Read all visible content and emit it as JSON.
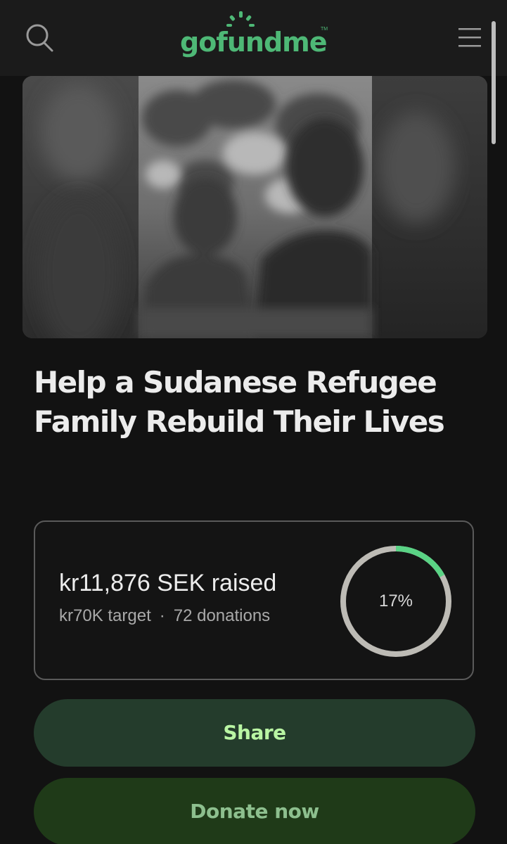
{
  "header": {
    "logo_text": "gofundme",
    "logo_tm": "TM",
    "search_icon": "search-icon",
    "menu_icon": "hamburger-menu-icon"
  },
  "hero": {
    "image_description": "blurred photo of refugee family",
    "colors": [
      "#3a3a3a",
      "#bdbdbd"
    ]
  },
  "campaign": {
    "title": "Help a Sudanese Refugee Family Rebuild Their Lives"
  },
  "stats": {
    "raised_text": "kr11,876 SEK raised",
    "target_text": "kr70K target",
    "separator": "·",
    "donations_text": "72 donations",
    "progress_label": "17%",
    "progress_fraction": 0.17
  },
  "actions": {
    "share_label": "Share",
    "donate_label": "Donate now"
  },
  "colors": {
    "brand_green": "#4eb876",
    "progress_green": "#5ad385",
    "progress_track": "#bdbbb5",
    "share_bg": "#243c2c",
    "donate_bg": "#1f3a18"
  }
}
